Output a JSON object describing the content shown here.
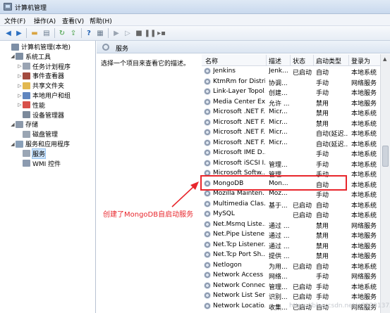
{
  "window": {
    "title": "计算机管理"
  },
  "menu": [
    "文件(F)",
    "操作(A)",
    "查看(V)",
    "帮助(H)"
  ],
  "toolbar_icons": [
    "back-icon",
    "forward-icon",
    "up-folder-icon",
    "properties-icon",
    "refresh-icon",
    "export-icon",
    "help-icon",
    "console-icon",
    "play-icon",
    "play-alt-icon",
    "stop-icon",
    "pause-icon",
    "restart-icon"
  ],
  "tree": [
    {
      "label": "计算机管理(本地)",
      "expander": "",
      "icon": "computer-icon",
      "color": "#7d8fa6"
    },
    {
      "label": "系统工具",
      "expander": "◢",
      "icon": "tools-icon",
      "color": "#7f8fa3"
    },
    {
      "label": "任务计划程序",
      "expander": "▷",
      "icon": "clock-icon",
      "color": "#9aa4b3"
    },
    {
      "label": "事件查看器",
      "expander": "▷",
      "icon": "event-viewer-icon",
      "color": "#a34b3f"
    },
    {
      "label": "共享文件夹",
      "expander": "▷",
      "icon": "shared-folder-icon",
      "color": "#e2b84f"
    },
    {
      "label": "本地用户和组",
      "expander": "▷",
      "icon": "users-icon",
      "color": "#5f86c0"
    },
    {
      "label": "性能",
      "expander": "▷",
      "icon": "performance-icon",
      "color": "#d8504a"
    },
    {
      "label": "设备管理器",
      "expander": "",
      "icon": "device-manager-icon",
      "color": "#7c8a9c"
    },
    {
      "label": "存储",
      "expander": "◢",
      "icon": "storage-icon",
      "color": "#8d9aab"
    },
    {
      "label": "磁盘管理",
      "expander": "",
      "icon": "disk-icon",
      "color": "#9aa5b3"
    },
    {
      "label": "服务和应用程序",
      "expander": "◢",
      "icon": "services-apps-icon",
      "color": "#8aa0b8"
    },
    {
      "label": "服务",
      "expander": "",
      "icon": "services-icon",
      "color": "#9aa6b5"
    },
    {
      "label": "WMI 控件",
      "expander": "",
      "icon": "wmi-icon",
      "color": "#8c9bb0"
    }
  ],
  "pane": {
    "title": "服务",
    "description": "选择一个项目来查看它的描述。"
  },
  "columns": [
    "名称",
    "描述",
    "状态",
    "启动类型",
    "登录为"
  ],
  "services": [
    {
      "name": "Jenkins",
      "desc": "Jenk...",
      "status": "已启动",
      "startup": "自动",
      "logon": "本地系统"
    },
    {
      "name": "KtmRm for Distri...",
      "desc": "协调...",
      "status": "",
      "startup": "手动",
      "logon": "网络服务"
    },
    {
      "name": "Link-Layer Topol...",
      "desc": "创建...",
      "status": "",
      "startup": "手动",
      "logon": "本地服务"
    },
    {
      "name": "Media Center Ex...",
      "desc": "允许 ...",
      "status": "",
      "startup": "禁用",
      "logon": "本地服务"
    },
    {
      "name": "Microsoft .NET F...",
      "desc": "Micr...",
      "status": "",
      "startup": "禁用",
      "logon": "本地系统"
    },
    {
      "name": "Microsoft .NET F...",
      "desc": "Micr...",
      "status": "",
      "startup": "禁用",
      "logon": "本地系统"
    },
    {
      "name": "Microsoft .NET F...",
      "desc": "Micr...",
      "status": "",
      "startup": "自动(延迟...",
      "logon": "本地系统"
    },
    {
      "name": "Microsoft .NET F...",
      "desc": "Micr...",
      "status": "",
      "startup": "自动(延迟...",
      "logon": "本地系统"
    },
    {
      "name": "Microsoft IME D...",
      "desc": "",
      "status": "",
      "startup": "手动",
      "logon": "本地系统"
    },
    {
      "name": "Microsoft iSCSI I...",
      "desc": "管理...",
      "status": "",
      "startup": "手动",
      "logon": "本地系统"
    },
    {
      "name": "Microsoft Softw...",
      "desc": "管理...",
      "status": "",
      "startup": "手动",
      "logon": "本地系统"
    },
    {
      "name": "MongoDB",
      "desc": "Mon...",
      "status": "",
      "startup": "自动",
      "logon": "本地系统"
    },
    {
      "name": "Mozilla Mainten...",
      "desc": "Moz...",
      "status": "",
      "startup": "手动",
      "logon": "本地系统"
    },
    {
      "name": "Multimedia Clas...",
      "desc": "基于...",
      "status": "已启动",
      "startup": "自动",
      "logon": "本地系统"
    },
    {
      "name": "MySQL",
      "desc": "",
      "status": "已启动",
      "startup": "自动",
      "logon": "本地系统"
    },
    {
      "name": "Net.Msmq Liste...",
      "desc": "通过 ...",
      "status": "",
      "startup": "禁用",
      "logon": "网络服务"
    },
    {
      "name": "Net.Pipe Listene...",
      "desc": "通过 ...",
      "status": "",
      "startup": "禁用",
      "logon": "本地服务"
    },
    {
      "name": "Net.Tcp Listener...",
      "desc": "通过 ...",
      "status": "",
      "startup": "禁用",
      "logon": "本地服务"
    },
    {
      "name": "Net.Tcp Port Sh...",
      "desc": "提供 ...",
      "status": "",
      "startup": "禁用",
      "logon": "本地服务"
    },
    {
      "name": "Netlogon",
      "desc": "为用...",
      "status": "已启动",
      "startup": "自动",
      "logon": "本地系统"
    },
    {
      "name": "Network Access ...",
      "desc": "网络...",
      "status": "",
      "startup": "手动",
      "logon": "网络服务"
    },
    {
      "name": "Network Connec...",
      "desc": "管理...",
      "status": "已启动",
      "startup": "手动",
      "logon": "本地系统"
    },
    {
      "name": "Network List Ser...",
      "desc": "识别...",
      "status": "已启动",
      "startup": "手动",
      "logon": "本地服务"
    },
    {
      "name": "Network Locatio...",
      "desc": "收集...",
      "status": "已启动",
      "startup": "自动",
      "logon": "网络服务"
    }
  ],
  "annotation": {
    "text": "创建了MongoDB自启动服务",
    "color": "#e8262c"
  },
  "watermark": "https://blog.csdn.net/u01301372"
}
